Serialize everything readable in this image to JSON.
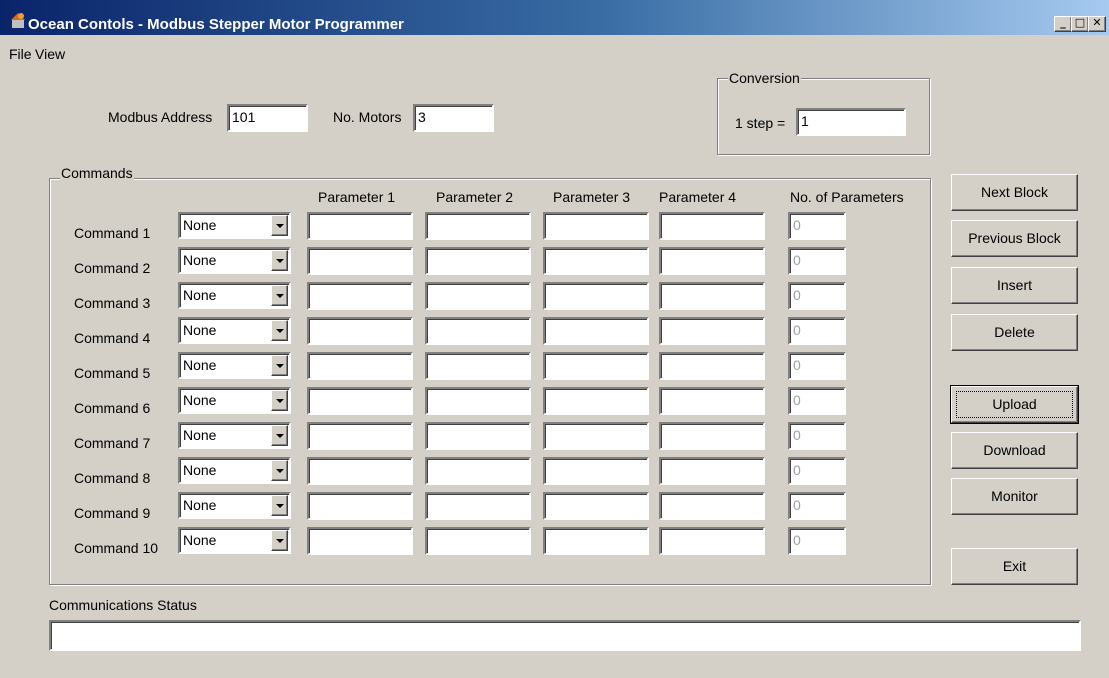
{
  "window": {
    "title": "Ocean Contols - Modbus Stepper Motor Programmer",
    "minimize": "_",
    "maximize": "□",
    "close": "✕"
  },
  "menu": [
    {
      "label": "File"
    },
    {
      "label": "View"
    }
  ],
  "settings": {
    "modbus_address_label": "Modbus Address",
    "modbus_address_value": "101",
    "motors_label": "No. Motors",
    "motors_value": "3"
  },
  "conversion": {
    "legend": "Conversion",
    "label": "1 step =",
    "value": "1"
  },
  "commands": {
    "legend": "Commands",
    "headers": {
      "p1": "Parameter 1",
      "p2": "Parameter 2",
      "p3": "Parameter 3",
      "p4": "Parameter 4",
      "count": "No. of Parameters"
    },
    "rows": [
      {
        "label": "Command 1",
        "command": "None",
        "p1": "",
        "p2": "",
        "p3": "",
        "p4": "",
        "count": "0"
      },
      {
        "label": "Command 2",
        "command": "None",
        "p1": "",
        "p2": "",
        "p3": "",
        "p4": "",
        "count": "0"
      },
      {
        "label": "Command 3",
        "command": "None",
        "p1": "",
        "p2": "",
        "p3": "",
        "p4": "",
        "count": "0"
      },
      {
        "label": "Command 4",
        "command": "None",
        "p1": "",
        "p2": "",
        "p3": "",
        "p4": "",
        "count": "0"
      },
      {
        "label": "Command 5",
        "command": "None",
        "p1": "",
        "p2": "",
        "p3": "",
        "p4": "",
        "count": "0"
      },
      {
        "label": "Command 6",
        "command": "None",
        "p1": "",
        "p2": "",
        "p3": "",
        "p4": "",
        "count": "0"
      },
      {
        "label": "Command 7",
        "command": "None",
        "p1": "",
        "p2": "",
        "p3": "",
        "p4": "",
        "count": "0"
      },
      {
        "label": "Command 8",
        "command": "None",
        "p1": "",
        "p2": "",
        "p3": "",
        "p4": "",
        "count": "0"
      },
      {
        "label": "Command 9",
        "command": "None",
        "p1": "",
        "p2": "",
        "p3": "",
        "p4": "",
        "count": "0"
      },
      {
        "label": "Command 10",
        "command": "None",
        "p1": "",
        "p2": "",
        "p3": "",
        "p4": "",
        "count": "0"
      }
    ]
  },
  "buttons": {
    "next_block": "Next Block",
    "previous_block": "Previous Block",
    "insert": "Insert",
    "delete": "Delete",
    "upload": "Upload",
    "download": "Download",
    "monitor": "Monitor",
    "exit": "Exit"
  },
  "status": {
    "label": "Communications Status",
    "value": ""
  }
}
